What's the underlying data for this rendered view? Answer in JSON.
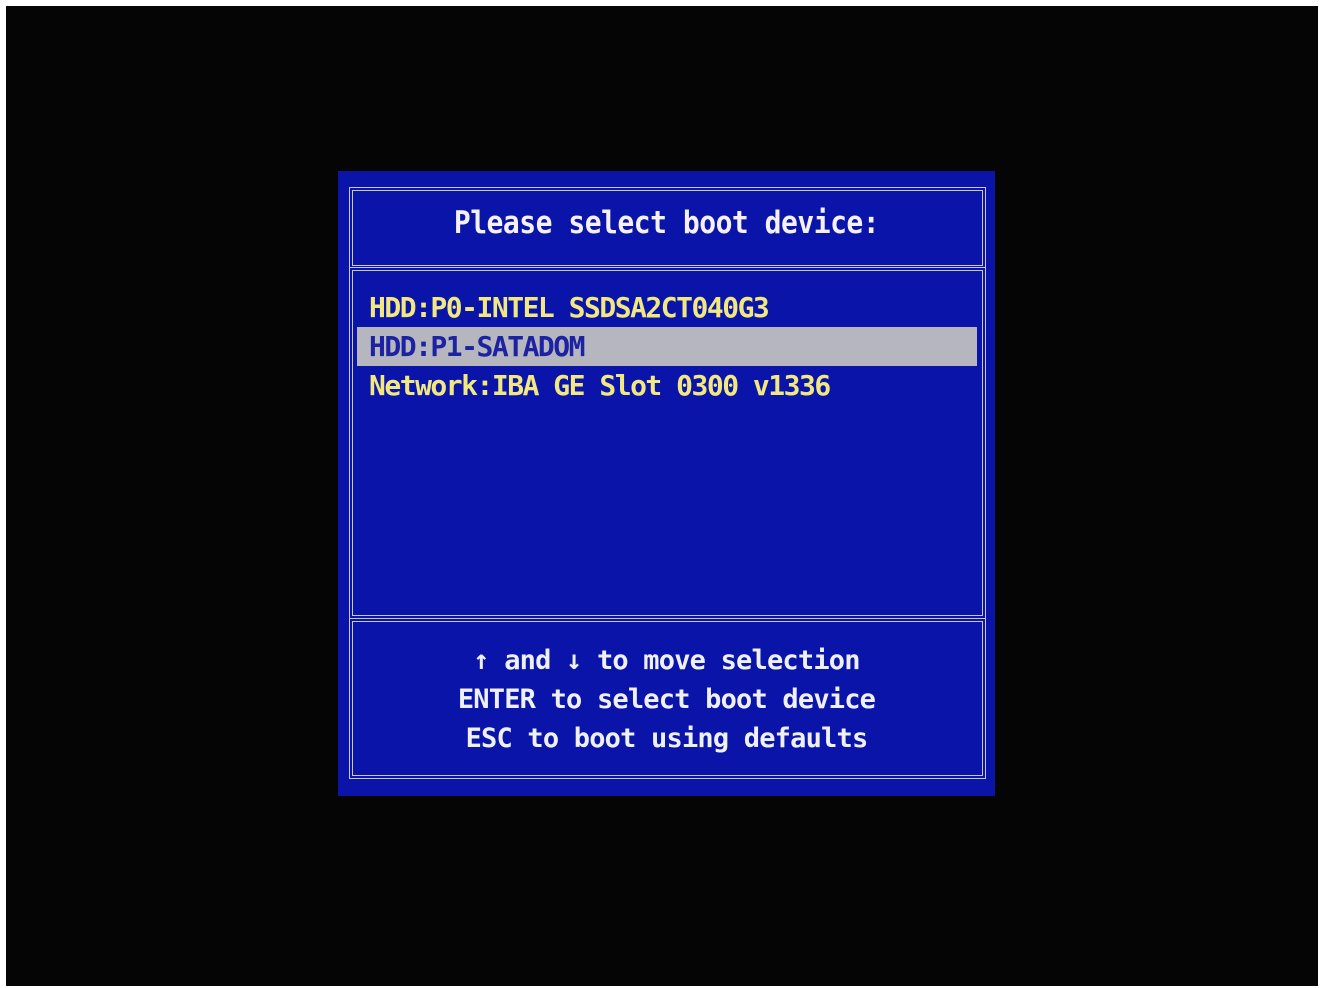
{
  "dialog": {
    "title": "Please select boot device:"
  },
  "boot_devices": [
    {
      "label": "HDD:P0-INTEL SSDSA2CT040G3",
      "selected": false
    },
    {
      "label": "HDD:P1-SATADOM",
      "selected": true
    },
    {
      "label": "Network:IBA GE Slot 0300 v1336",
      "selected": false
    }
  ],
  "help": [
    "↑ and ↓ to move selection",
    "ENTER to select boot device",
    "ESC to boot using defaults"
  ],
  "colors": {
    "screen_bg": "#050505",
    "dialog_bg": "#0a14a8",
    "border": "#c8c8d8",
    "item_text": "#f2e880",
    "selected_bg": "#b6b6be",
    "selected_text": "#1c22a2",
    "title_text": "#f4f0f4"
  }
}
